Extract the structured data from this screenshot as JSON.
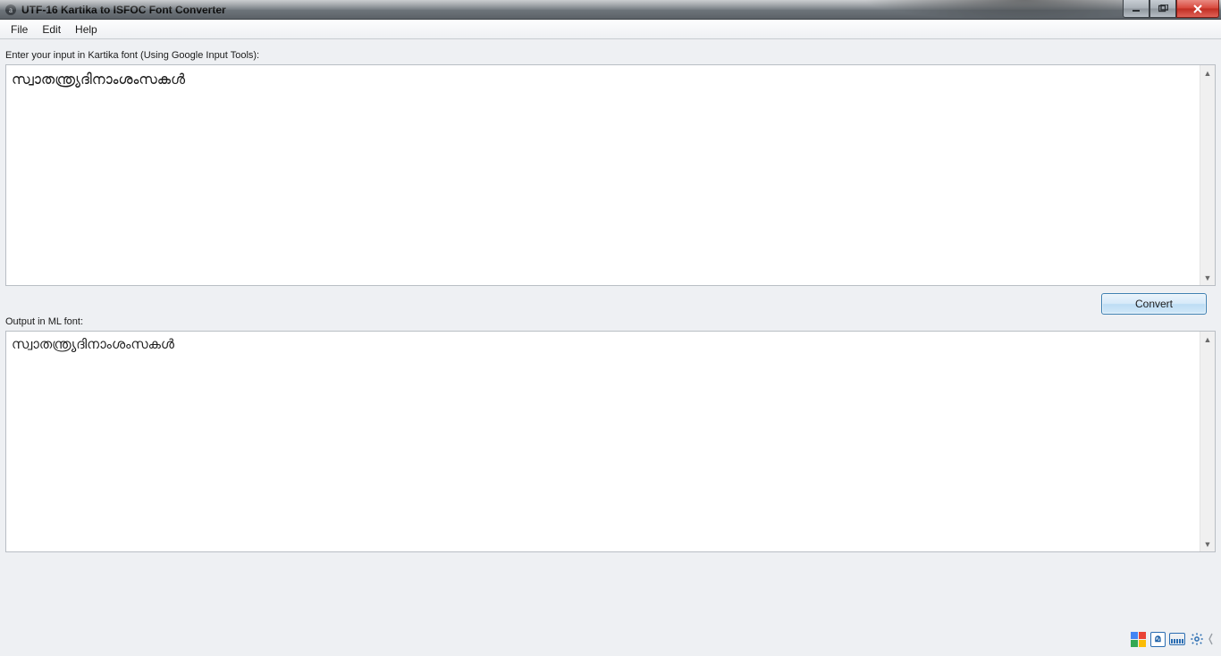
{
  "window": {
    "title": "UTF-16 Kartika to ISFOC Font Converter"
  },
  "menu": {
    "file": "File",
    "edit": "Edit",
    "help": "Help"
  },
  "labels": {
    "input": "Enter your input in Kartika font (Using Google Input Tools):",
    "output": "Output in ML font:"
  },
  "buttons": {
    "convert": "Convert"
  },
  "content": {
    "input_text": "സ്വാതന്ത്ര്യദിനാംശംസകൾ",
    "output_text": "സ്വാതന്ത്ര്യദിനാംശംസകൾ"
  },
  "tray": {
    "lang_badge": "മ"
  }
}
